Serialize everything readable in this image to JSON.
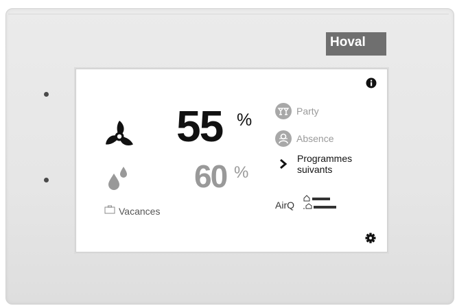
{
  "brand": {
    "logo_text": "Hoval"
  },
  "fan": {
    "value": "55",
    "unit": "%"
  },
  "humidity": {
    "value": "60",
    "unit": "%"
  },
  "menu": {
    "party_label": "Party",
    "absence_label": "Absence",
    "next_programs_line1": "Programmes",
    "next_programs_line2": "suivants"
  },
  "vacation": {
    "label": "Vacances"
  },
  "air_quality": {
    "label": "AirQ"
  },
  "icons": {
    "info": "info-icon",
    "settings": "gear-icon",
    "fan": "fan-icon",
    "humidity": "water-drops-icon",
    "party": "cocktail-glasses-icon",
    "absence": "person-away-icon",
    "chevron": "chevron-right-icon",
    "vacation": "suitcase-icon",
    "air_quality_bars": "indoor-outdoor-bars-icon"
  },
  "colors": {
    "primary_text": "#111111",
    "secondary_text": "#9a9a9a",
    "logo_background": "#6f6f6f"
  }
}
